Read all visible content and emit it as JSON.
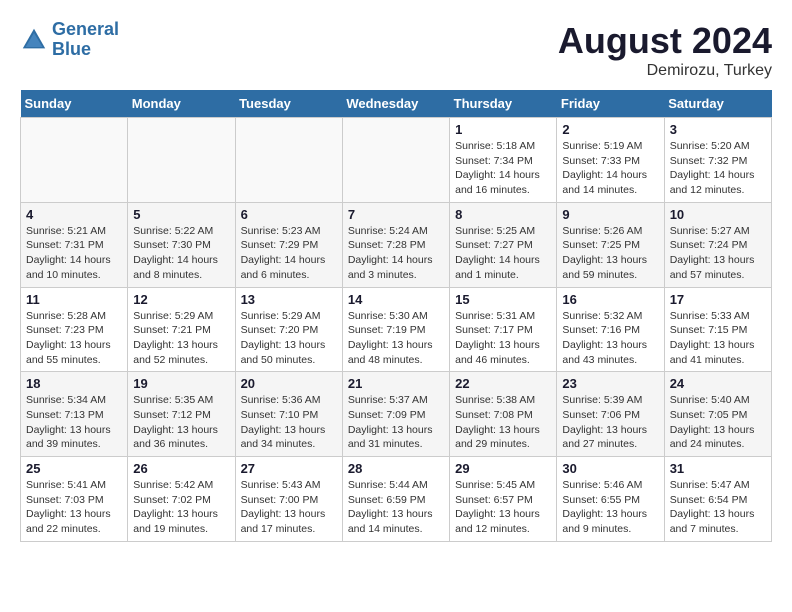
{
  "header": {
    "logo_line1": "General",
    "logo_line2": "Blue",
    "month_year": "August 2024",
    "location": "Demirozu, Turkey"
  },
  "weekdays": [
    "Sunday",
    "Monday",
    "Tuesday",
    "Wednesday",
    "Thursday",
    "Friday",
    "Saturday"
  ],
  "weeks": [
    [
      {
        "day": "",
        "detail": ""
      },
      {
        "day": "",
        "detail": ""
      },
      {
        "day": "",
        "detail": ""
      },
      {
        "day": "",
        "detail": ""
      },
      {
        "day": "1",
        "detail": "Sunrise: 5:18 AM\nSunset: 7:34 PM\nDaylight: 14 hours\nand 16 minutes."
      },
      {
        "day": "2",
        "detail": "Sunrise: 5:19 AM\nSunset: 7:33 PM\nDaylight: 14 hours\nand 14 minutes."
      },
      {
        "day": "3",
        "detail": "Sunrise: 5:20 AM\nSunset: 7:32 PM\nDaylight: 14 hours\nand 12 minutes."
      }
    ],
    [
      {
        "day": "4",
        "detail": "Sunrise: 5:21 AM\nSunset: 7:31 PM\nDaylight: 14 hours\nand 10 minutes."
      },
      {
        "day": "5",
        "detail": "Sunrise: 5:22 AM\nSunset: 7:30 PM\nDaylight: 14 hours\nand 8 minutes."
      },
      {
        "day": "6",
        "detail": "Sunrise: 5:23 AM\nSunset: 7:29 PM\nDaylight: 14 hours\nand 6 minutes."
      },
      {
        "day": "7",
        "detail": "Sunrise: 5:24 AM\nSunset: 7:28 PM\nDaylight: 14 hours\nand 3 minutes."
      },
      {
        "day": "8",
        "detail": "Sunrise: 5:25 AM\nSunset: 7:27 PM\nDaylight: 14 hours\nand 1 minute."
      },
      {
        "day": "9",
        "detail": "Sunrise: 5:26 AM\nSunset: 7:25 PM\nDaylight: 13 hours\nand 59 minutes."
      },
      {
        "day": "10",
        "detail": "Sunrise: 5:27 AM\nSunset: 7:24 PM\nDaylight: 13 hours\nand 57 minutes."
      }
    ],
    [
      {
        "day": "11",
        "detail": "Sunrise: 5:28 AM\nSunset: 7:23 PM\nDaylight: 13 hours\nand 55 minutes."
      },
      {
        "day": "12",
        "detail": "Sunrise: 5:29 AM\nSunset: 7:21 PM\nDaylight: 13 hours\nand 52 minutes."
      },
      {
        "day": "13",
        "detail": "Sunrise: 5:29 AM\nSunset: 7:20 PM\nDaylight: 13 hours\nand 50 minutes."
      },
      {
        "day": "14",
        "detail": "Sunrise: 5:30 AM\nSunset: 7:19 PM\nDaylight: 13 hours\nand 48 minutes."
      },
      {
        "day": "15",
        "detail": "Sunrise: 5:31 AM\nSunset: 7:17 PM\nDaylight: 13 hours\nand 46 minutes."
      },
      {
        "day": "16",
        "detail": "Sunrise: 5:32 AM\nSunset: 7:16 PM\nDaylight: 13 hours\nand 43 minutes."
      },
      {
        "day": "17",
        "detail": "Sunrise: 5:33 AM\nSunset: 7:15 PM\nDaylight: 13 hours\nand 41 minutes."
      }
    ],
    [
      {
        "day": "18",
        "detail": "Sunrise: 5:34 AM\nSunset: 7:13 PM\nDaylight: 13 hours\nand 39 minutes."
      },
      {
        "day": "19",
        "detail": "Sunrise: 5:35 AM\nSunset: 7:12 PM\nDaylight: 13 hours\nand 36 minutes."
      },
      {
        "day": "20",
        "detail": "Sunrise: 5:36 AM\nSunset: 7:10 PM\nDaylight: 13 hours\nand 34 minutes."
      },
      {
        "day": "21",
        "detail": "Sunrise: 5:37 AM\nSunset: 7:09 PM\nDaylight: 13 hours\nand 31 minutes."
      },
      {
        "day": "22",
        "detail": "Sunrise: 5:38 AM\nSunset: 7:08 PM\nDaylight: 13 hours\nand 29 minutes."
      },
      {
        "day": "23",
        "detail": "Sunrise: 5:39 AM\nSunset: 7:06 PM\nDaylight: 13 hours\nand 27 minutes."
      },
      {
        "day": "24",
        "detail": "Sunrise: 5:40 AM\nSunset: 7:05 PM\nDaylight: 13 hours\nand 24 minutes."
      }
    ],
    [
      {
        "day": "25",
        "detail": "Sunrise: 5:41 AM\nSunset: 7:03 PM\nDaylight: 13 hours\nand 22 minutes."
      },
      {
        "day": "26",
        "detail": "Sunrise: 5:42 AM\nSunset: 7:02 PM\nDaylight: 13 hours\nand 19 minutes."
      },
      {
        "day": "27",
        "detail": "Sunrise: 5:43 AM\nSunset: 7:00 PM\nDaylight: 13 hours\nand 17 minutes."
      },
      {
        "day": "28",
        "detail": "Sunrise: 5:44 AM\nSunset: 6:59 PM\nDaylight: 13 hours\nand 14 minutes."
      },
      {
        "day": "29",
        "detail": "Sunrise: 5:45 AM\nSunset: 6:57 PM\nDaylight: 13 hours\nand 12 minutes."
      },
      {
        "day": "30",
        "detail": "Sunrise: 5:46 AM\nSunset: 6:55 PM\nDaylight: 13 hours\nand 9 minutes."
      },
      {
        "day": "31",
        "detail": "Sunrise: 5:47 AM\nSunset: 6:54 PM\nDaylight: 13 hours\nand 7 minutes."
      }
    ]
  ]
}
